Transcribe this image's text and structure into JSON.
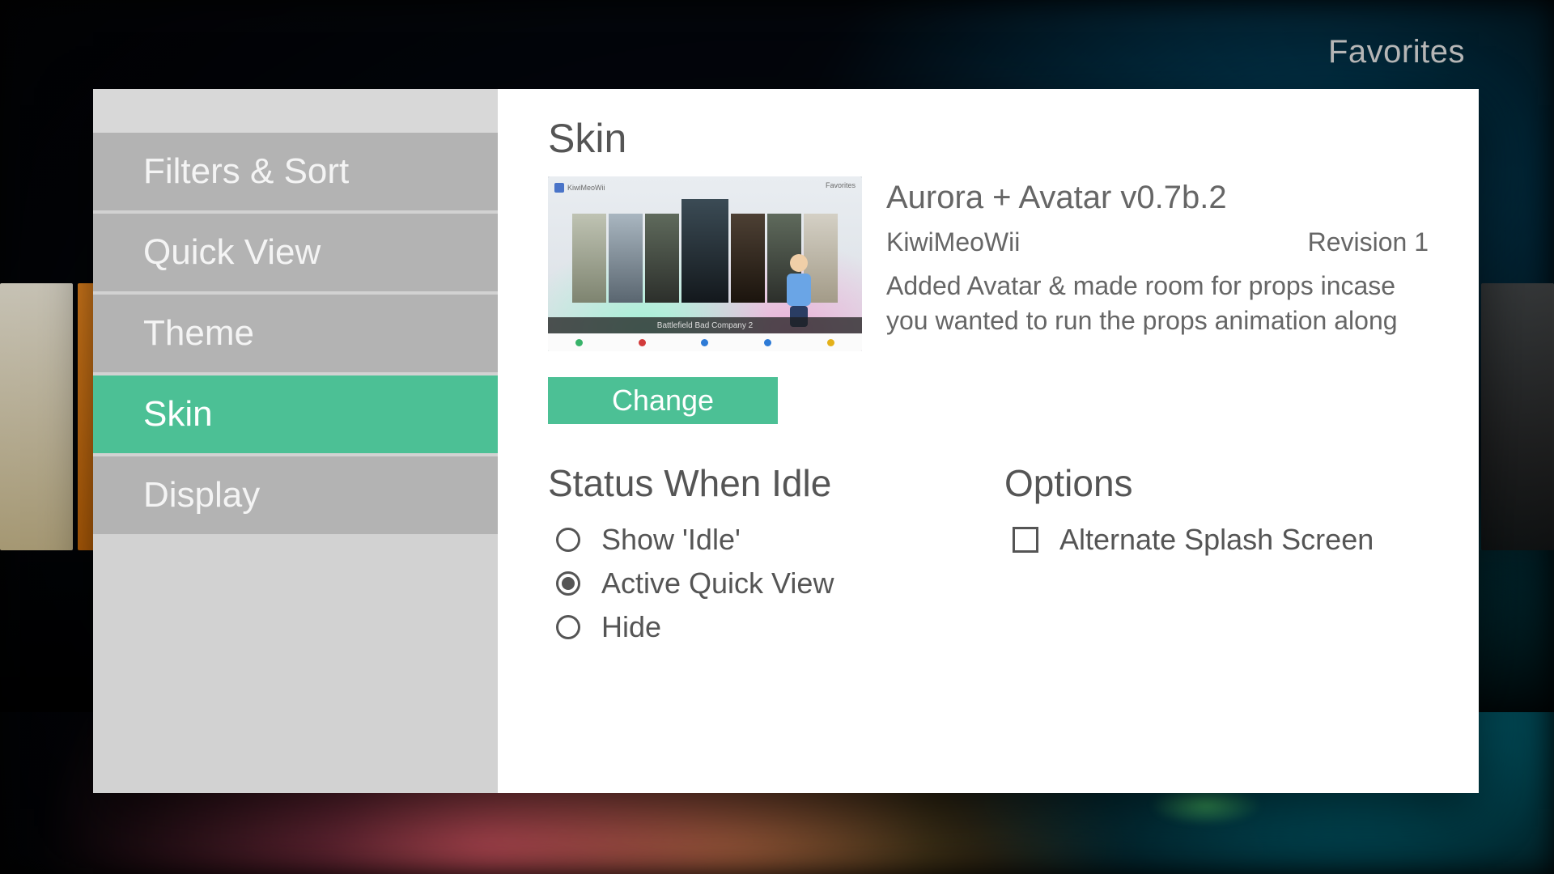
{
  "header": {
    "favorites": "Favorites"
  },
  "sidebar": {
    "items": [
      {
        "label": "Filters & Sort",
        "active": false
      },
      {
        "label": "Quick View",
        "active": false
      },
      {
        "label": "Theme",
        "active": false
      },
      {
        "label": "Skin",
        "active": true
      },
      {
        "label": "Display",
        "active": false
      }
    ]
  },
  "skin": {
    "section_title": "Skin",
    "name": "Aurora + Avatar v0.7b.2",
    "author": "KiwiMeoWii",
    "revision": "Revision 1",
    "description": "Added Avatar & made room for props incase you wanted to run the props animation along",
    "change_label": "Change",
    "preview_caption": "Battlefield Bad Company 2"
  },
  "idle": {
    "title": "Status When Idle",
    "options": [
      {
        "label": "Show 'Idle'",
        "selected": false
      },
      {
        "label": "Active Quick View",
        "selected": true
      },
      {
        "label": "Hide",
        "selected": false
      }
    ]
  },
  "options": {
    "title": "Options",
    "items": [
      {
        "label": "Alternate Splash Screen",
        "checked": false
      }
    ]
  }
}
